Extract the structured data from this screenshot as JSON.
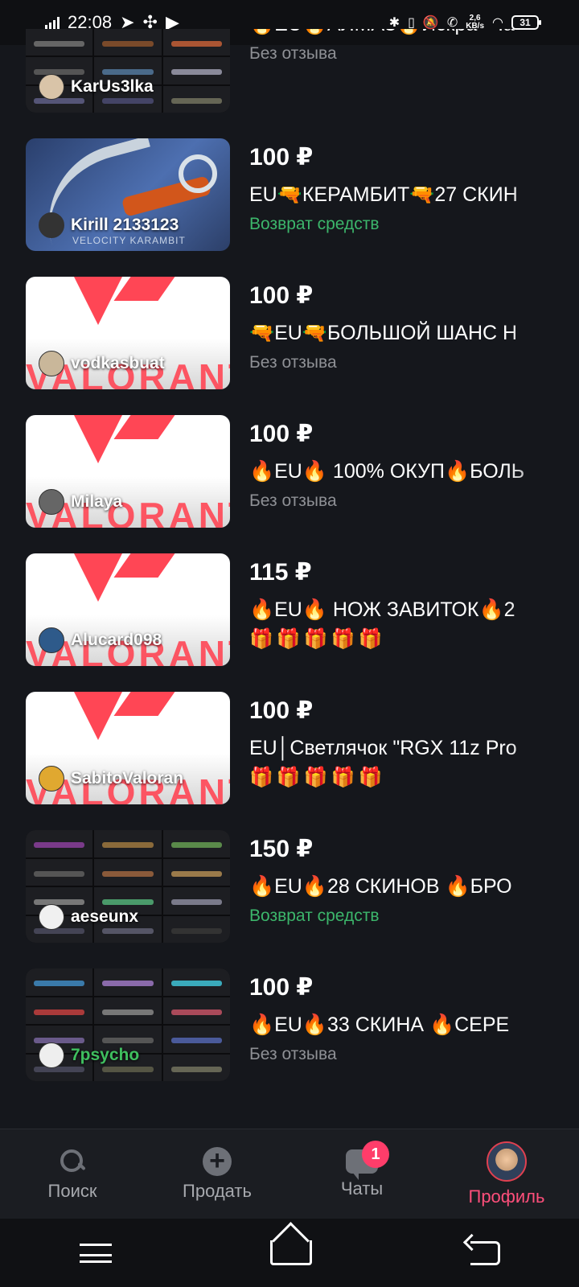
{
  "status_bar": {
    "time": "22:08",
    "speed_value": "2,6",
    "speed_unit": "KB/s",
    "battery": "31",
    "icons": [
      "signal-icon",
      "telegram-icon",
      "app-icon",
      "youtube-icon",
      "bluetooth-icon",
      "vibrate-icon",
      "mute-icon",
      "wifi-call-icon",
      "wifi-icon",
      "battery-icon"
    ]
  },
  "listings": [
    {
      "seller": "KarUs3lka",
      "price": "",
      "title": "🔥EU🔥АЛМАЗ🔥Искра \"Ча",
      "status": "Без отзыва",
      "status_type": "none",
      "thumb": "grid"
    },
    {
      "seller": "Kirill 2133123",
      "price": "100 ₽",
      "title": "EU🔫КЕРАМБИТ🔫27 СКИН",
      "status": "Возврат средств",
      "status_type": "refund",
      "thumb": "knife",
      "thumb_caption": "VELOCITY KARAMBIT"
    },
    {
      "seller": "vodkasbuat",
      "price": "100 ₽",
      "title": "🔫EU🔫БОЛЬШОЙ ШАНС Н",
      "status": "Без отзыва",
      "status_type": "none",
      "thumb": "val"
    },
    {
      "seller": "Milaya",
      "price": "100 ₽",
      "title": "🔥EU🔥 100% ОКУП🔥БОЛЬ",
      "status": "Без отзыва",
      "status_type": "none",
      "thumb": "val"
    },
    {
      "seller": "Alucard098",
      "price": "115 ₽",
      "title": "🔥EU🔥 НОЖ ЗАВИТОК🔥2",
      "status": "🎁🎁🎁🎁🎁",
      "status_type": "gifts",
      "thumb": "val"
    },
    {
      "seller": "SabitoValoran",
      "price": "100 ₽",
      "title": "EU│Светлячок \"RGX 11z Pro",
      "status": "🎁🎁🎁🎁🎁",
      "status_type": "gifts",
      "thumb": "val"
    },
    {
      "seller": "aeseunx",
      "price": "150 ₽",
      "title": "🔥EU🔥28 СКИНОВ 🔥БРО",
      "status": "Возврат средств",
      "status_type": "refund",
      "thumb": "grid"
    },
    {
      "seller": "7psycho",
      "price": "100 ₽",
      "title": "🔥EU🔥33 СКИНА 🔥СЕРЕ",
      "status": "Без отзыва",
      "status_type": "none",
      "thumb": "grid",
      "seller_green": true
    }
  ],
  "valorant_watermark": "VALORANT",
  "bottom_nav": {
    "search": "Поиск",
    "sell": "Продать",
    "chats": "Чаты",
    "chats_badge": "1",
    "profile": "Профиль"
  },
  "colors": {
    "background": "#15171c",
    "accent": "#ff4f7b",
    "refund": "#3cb66b",
    "muted": "#8e9095",
    "valorant_red": "#ff4655"
  }
}
